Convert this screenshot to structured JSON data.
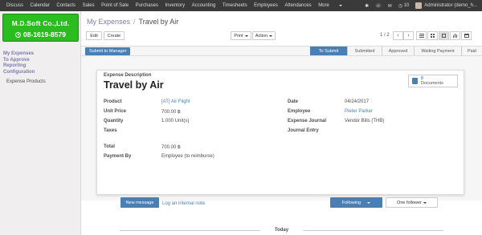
{
  "topbar": {
    "menu": [
      "Discuss",
      "Calendar",
      "Contacts",
      "Sales",
      "Point of Sale",
      "Purchases",
      "Inventory",
      "Accounting",
      "Timesheets",
      "Employees",
      "Attendances",
      "More"
    ],
    "messages_count": "",
    "notifications_count": "10",
    "user": "Administrator (demo_h..."
  },
  "logo": {
    "company": "M.D.Soft Co.,Ltd.",
    "phone": "08-1619-8579"
  },
  "sidebar": {
    "items": [
      "My Expenses",
      "To Approve",
      "Reporting",
      "Configuration"
    ],
    "sub_items": [
      "Expense Products"
    ]
  },
  "breadcrumb": {
    "parent": "My Expenses",
    "current": "Travel by Air"
  },
  "toolbar": {
    "edit": "Edit",
    "create": "Create",
    "print": "Print",
    "action": "Action",
    "pager": "1 / 2"
  },
  "statusbar": {
    "submit_button": "Submit to Manager",
    "stages": [
      "To Submit",
      "Submitted",
      "Approved",
      "Waiting Payment",
      "Paid"
    ],
    "current_stage": "To Submit"
  },
  "sheet": {
    "label": "Expense Description",
    "title": "Travel by Air",
    "documents_count": "0",
    "documents_label": "Documents",
    "left_fields": [
      {
        "label": "Product",
        "value": "[AT] Air Flight"
      },
      {
        "label": "Unit Price",
        "value": "700.00 ฿"
      },
      {
        "label": "Quantity",
        "value": "1.000 Unit(s)"
      },
      {
        "label": "Taxes",
        "value": ""
      }
    ],
    "right_fields": [
      {
        "label": "Date",
        "value": "04/24/2017"
      },
      {
        "label": "Employee",
        "value": "Pieter Parker"
      },
      {
        "label": "Expense Journal",
        "value": "Vendor Bills (THB)"
      },
      {
        "label": "Journal Entry",
        "value": ""
      }
    ],
    "total_label": "Total",
    "total_value": "700.00 ฿",
    "payment_label": "Payment By",
    "payment_value": "Employee (to reimburse)"
  },
  "chatter": {
    "new_message": "New message",
    "log_note": "Log an internal note",
    "following": "Following",
    "followers": "One follower",
    "today": "Today"
  },
  "colors": {
    "accent": "#4a7fb4",
    "link": "#7c7bad",
    "logo_bg": "#2bbd1f",
    "topbar": "#3a3a3a"
  }
}
